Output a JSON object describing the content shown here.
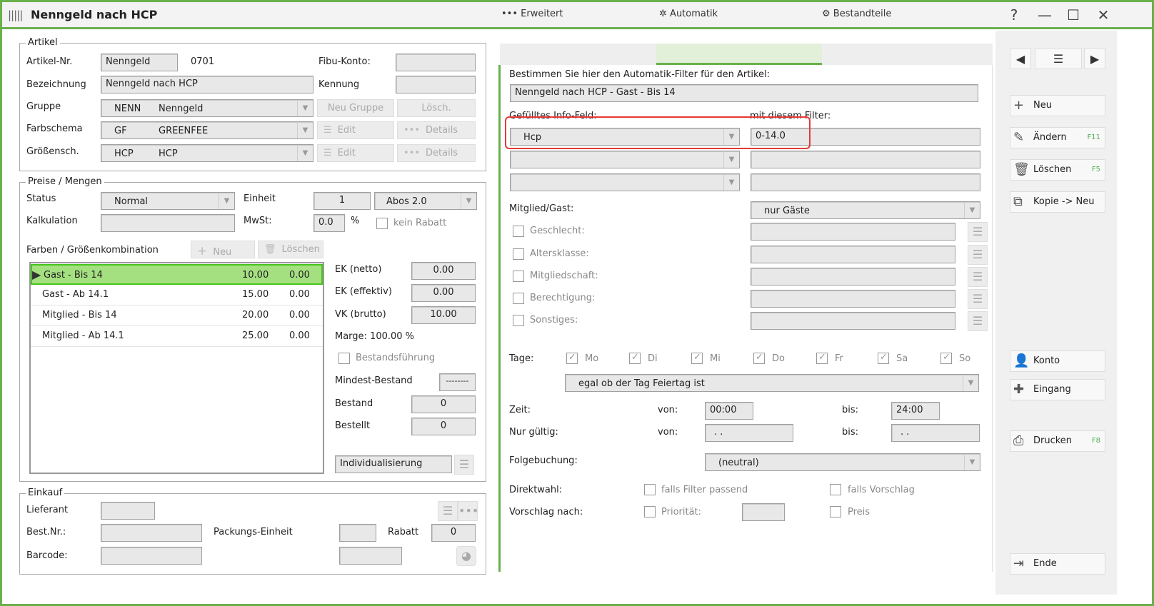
{
  "window": {
    "title": "Nenngeld nach HCP",
    "help": "?",
    "min": "—",
    "max": "☐",
    "close": "✕"
  },
  "artikel": {
    "group_title": "Artikel",
    "nr_label": "Artikel-Nr.",
    "nr_value": "Nenngeld",
    "nr_code": "0701",
    "fibu_label": "Fibu-Konto:",
    "fibu_value": "",
    "bez_label": "Bezeichnung",
    "bez_value": "Nenngeld nach HCP",
    "kennung_label": "Kennung",
    "kennung_value": "",
    "gruppe_label": "Gruppe",
    "gruppe_code": "NENN",
    "gruppe_name": "Nenngeld",
    "neu_gruppe": "Neu Gruppe",
    "losch": "Lösch.",
    "farb_label": "Farbschema",
    "farb_code": "GF",
    "farb_name": "GREENFEE",
    "groess_label": "Größensch.",
    "groess_code": "HCP",
    "groess_name": "HCP",
    "edit": "Edit",
    "details": "Details"
  },
  "preise": {
    "group_title": "Preise / Mengen",
    "status_label": "Status",
    "status_value": "Normal",
    "einheit_label": "Einheit",
    "einheit_value": "1",
    "einheit_combo": "Abos 2.0",
    "kalk_label": "Kalkulation",
    "kalk_value": "",
    "mwst_label": "MwSt:",
    "mwst_value": "0.0",
    "percent": "%",
    "kein_rabatt": "kein Rabatt",
    "farben_label": "Farben / Größenkombination",
    "neu": "Neu",
    "loeschen": "Löschen",
    "rows": [
      {
        "name": "Gast - Bis 14",
        "v1": "10.00",
        "v2": "0.00"
      },
      {
        "name": "Gast - Ab 14.1",
        "v1": "15.00",
        "v2": "0.00"
      },
      {
        "name": "Mitglied - Bis 14",
        "v1": "20.00",
        "v2": "0.00"
      },
      {
        "name": "Mitglied - Ab 14.1",
        "v1": "25.00",
        "v2": "0.00"
      }
    ],
    "ek_netto_label": "EK (netto)",
    "ek_netto": "0.00",
    "ek_eff_label": "EK (effektiv)",
    "ek_eff": "0.00",
    "vk_label": "VK (brutto)",
    "vk": "10.00",
    "marge": "Marge: 100.00 %",
    "bestand_fuehrung": "Bestandsführung",
    "mindest_label": "Mindest-Bestand",
    "mindest": "--------",
    "bestand_label": "Bestand",
    "bestand": "0",
    "bestellt_label": "Bestellt",
    "bestellt": "0",
    "individ": "Individualisierung"
  },
  "einkauf": {
    "group_title": "Einkauf",
    "lieferant_label": "Lieferant",
    "bestnr_label": "Best.Nr.:",
    "pack_label": "Packungs-Einheit",
    "rabatt_label": "Rabatt",
    "rabatt": "0",
    "barcode_label": "Barcode:"
  },
  "tabs": {
    "erweitert": "Erweitert",
    "automatik": "Automatik",
    "bestandteile": "Bestandteile"
  },
  "auto": {
    "intro": "Bestimmen Sie hier den Automatik-Filter für den Artikel:",
    "name": "Nenngeld nach HCP - Gast - Bis 14",
    "info_label": "Gefülltes Info-Feld:",
    "filter_label": "mit diesem Filter:",
    "info_value": "Hcp",
    "filter_value": "0-14.0",
    "mg_label": "Mitglied/Gast:",
    "mg_value": "nur Gäste",
    "geschlecht": "Geschlecht:",
    "alters": "Altersklasse:",
    "mitglied": "Mitgliedschaft:",
    "berecht": "Berechtigung:",
    "sonst": "Sonstiges:",
    "tage_label": "Tage:",
    "days": [
      "Mo",
      "Di",
      "Mi",
      "Do",
      "Fr",
      "Sa",
      "So"
    ],
    "feiertag": "egal ob der Tag Feiertag ist",
    "zeit_label": "Zeit:",
    "von": "von:",
    "bis": "bis:",
    "zeit_von": "00:00",
    "zeit_bis": "24:00",
    "gueltig_label": "Nur gültig:",
    "gueltig_von": ". .",
    "gueltig_bis": ". .",
    "folge_label": "Folgebuchung:",
    "folge_value": "(neutral)",
    "direkt_label": "Direktwahl:",
    "falls_filter": "falls Filter passend",
    "falls_vorschlag": "falls Vorschlag",
    "vorschlag_label": "Vorschlag nach:",
    "prioritaet": "Priorität:",
    "preis": "Preis"
  },
  "sidebar": {
    "neu": "Neu",
    "aendern": "Ändern",
    "aendern_key": "F11",
    "loeschen": "Löschen",
    "loeschen_key": "F5",
    "kopie": "Kopie -> Neu",
    "konto": "Konto",
    "eingang": "Eingang",
    "drucken": "Drucken",
    "drucken_key": "F8",
    "ende": "Ende"
  }
}
